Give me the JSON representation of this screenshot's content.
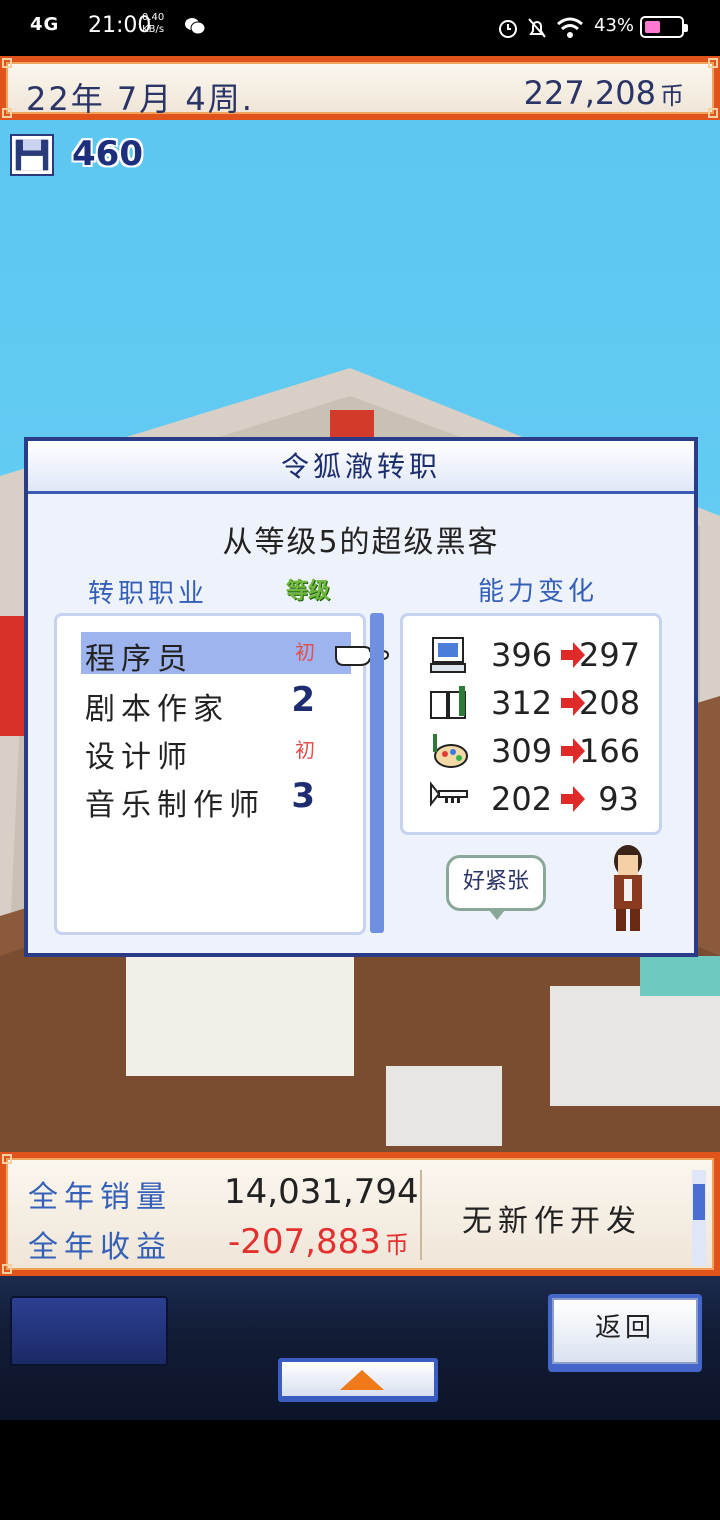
{
  "status_bar": {
    "signal": "4G",
    "time": "21:00",
    "speed_value": "0.40",
    "speed_unit": "KB/s",
    "battery_percent": "43%",
    "battery_level": 0.43
  },
  "top_bar": {
    "date": "22年 7月 4周.",
    "money": "227,208",
    "money_unit": "币"
  },
  "disk_count": "460",
  "dialog": {
    "title": "令狐澈转职",
    "subtitle": "从等级5的超级黑客",
    "job_header": "转职职业",
    "level_header": "等级",
    "ability_header": "能力变化",
    "jobs": [
      {
        "name": "程序员",
        "level": "初",
        "selected": true
      },
      {
        "name": "剧本作家",
        "level": "2"
      },
      {
        "name": "设计师",
        "level": "初"
      },
      {
        "name": "音乐制作师",
        "level": "3"
      }
    ],
    "abilities": [
      {
        "icon": "computer-icon",
        "from": "396",
        "to": "297"
      },
      {
        "icon": "book-icon",
        "from": "312",
        "to": "208"
      },
      {
        "icon": "palette-icon",
        "from": "309",
        "to": "166"
      },
      {
        "icon": "trumpet-icon",
        "from": "202",
        "to": "93"
      }
    ],
    "speech": "好紧张"
  },
  "stats": {
    "sales_label": "全年销量",
    "sales_value": "14,031,794",
    "revenue_label": "全年收益",
    "revenue_value": "-207,883",
    "revenue_unit": "币",
    "status": "无新作开发"
  },
  "buttons": {
    "back": "返回"
  },
  "colors": {
    "accent_orange": "#e0541b",
    "dialog_navy": "#2a3b88",
    "label_blue": "#3560b8",
    "negative_red": "#e53030"
  }
}
